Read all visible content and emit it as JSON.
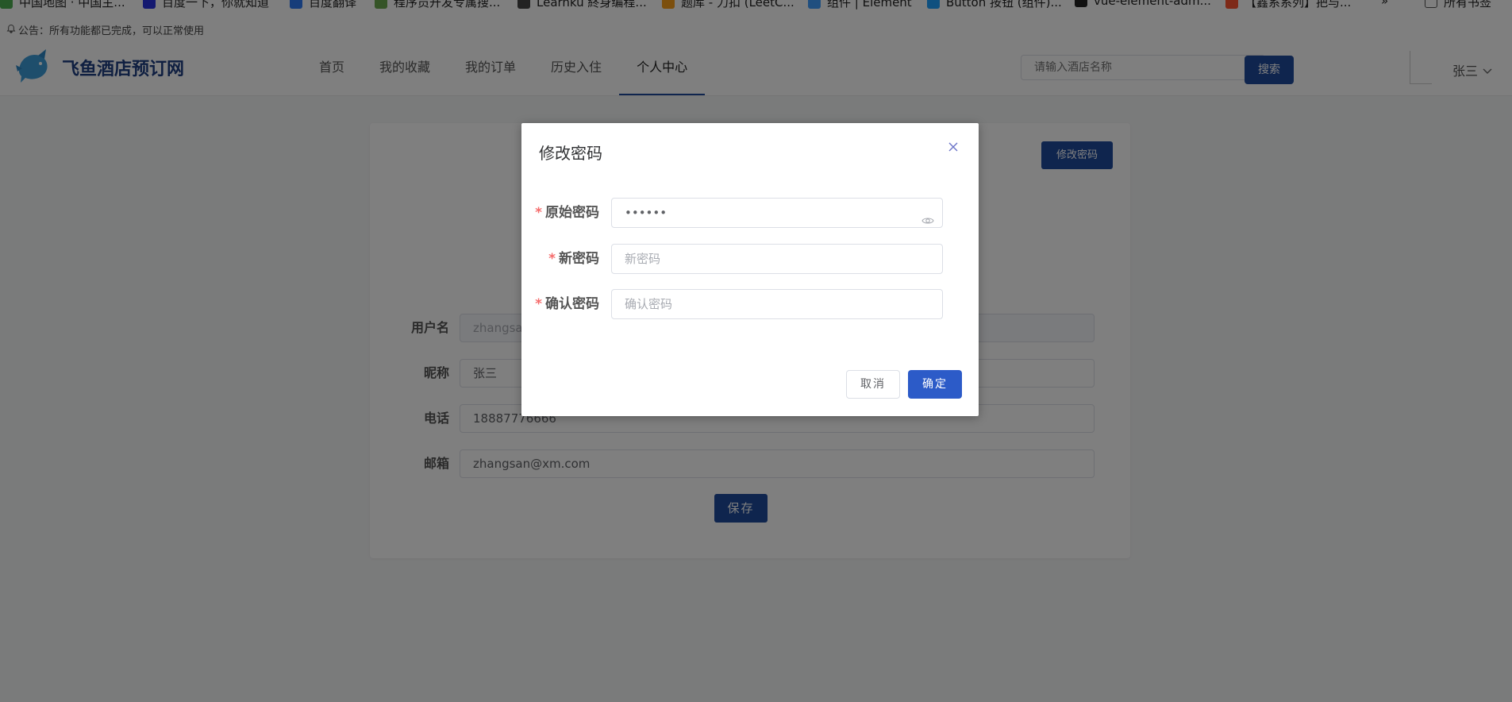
{
  "bookmarks": [
    {
      "label": "中国地图 · 中国主...",
      "icon": "map-icon",
      "color": "#4caf50"
    },
    {
      "label": "百度一下，你就知道",
      "icon": "baidu-icon",
      "color": "#2932e1"
    },
    {
      "label": "百度翻译",
      "icon": "translate-icon",
      "color": "#2f7bf5"
    },
    {
      "label": "程序员开发专属搜...",
      "icon": "robot-icon",
      "color": "#6aa84f"
    },
    {
      "label": "Learnku 終身编程...",
      "icon": "learnku-icon",
      "color": "#444444"
    },
    {
      "label": "题库 - 力扣 (LeetC...",
      "icon": "leetcode-icon",
      "color": "#f89f1b"
    },
    {
      "label": "组件 | Element",
      "icon": "element-icon",
      "color": "#409eff"
    },
    {
      "label": "Button 按钮 (组件)...",
      "icon": "cloud-icon",
      "color": "#1ea0ff"
    },
    {
      "label": "vue-element-adm...",
      "icon": "github-icon",
      "color": "#222222"
    },
    {
      "label": "【鑫系系列】把与...",
      "icon": "csdn-icon",
      "color": "#fc5531"
    }
  ],
  "bookmarks_more": "»",
  "bookmarks_all": "所有书签",
  "notice": {
    "icon": "bell-icon",
    "text": "公告：所有功能都已完成，可以正常使用"
  },
  "header": {
    "logo_text": "飞鱼酒店预订网",
    "nav": [
      {
        "label": "首页",
        "active": false
      },
      {
        "label": "我的收藏",
        "active": false
      },
      {
        "label": "我的订单",
        "active": false
      },
      {
        "label": "历史入住",
        "active": false
      },
      {
        "label": "个人中心",
        "active": true
      }
    ],
    "search_placeholder": "请输入酒店名称",
    "search_button": "搜索",
    "username": "张三"
  },
  "profile": {
    "change_password_button": "修改密码",
    "fields": [
      {
        "label": "用户名",
        "value": "zhangsan",
        "disabled": true
      },
      {
        "label": "昵称",
        "value": "张三",
        "disabled": false
      },
      {
        "label": "电话",
        "value": "18887776666",
        "disabled": false
      },
      {
        "label": "邮箱",
        "value": "zhangsan@xm.com",
        "disabled": false
      }
    ],
    "save_button": "保存"
  },
  "dialog": {
    "title": "修改密码",
    "fields": [
      {
        "label": "原始密码",
        "value": "••••••",
        "placeholder": ""
      },
      {
        "label": "新密码",
        "value": "",
        "placeholder": "新密码"
      },
      {
        "label": "确认密码",
        "value": "",
        "placeholder": "确认密码"
      }
    ],
    "required_mark": "*",
    "cancel": "取消",
    "confirm": "确定"
  },
  "colors": {
    "primary": "#1f4a9d",
    "confirm": "#2c5bc8",
    "required": "#f56c6c",
    "logo_blue": "#3d9dd9"
  }
}
